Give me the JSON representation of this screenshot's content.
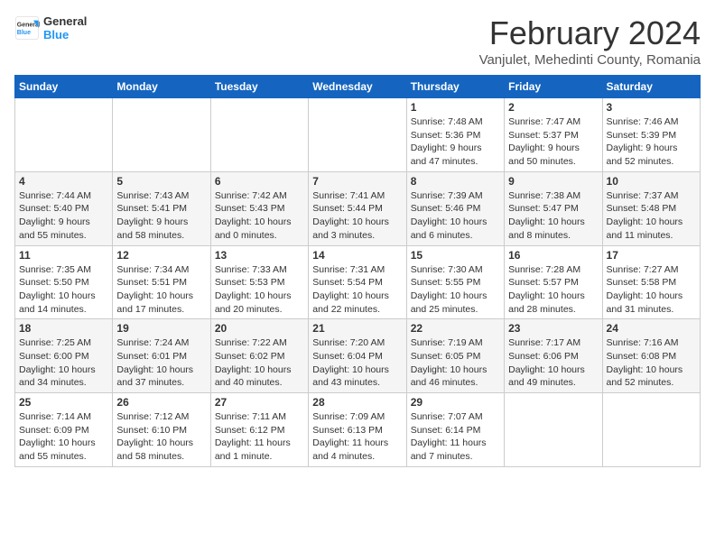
{
  "header": {
    "logo_line1": "General",
    "logo_line2": "Blue",
    "title": "February 2024",
    "subtitle": "Vanjulet, Mehedinti County, Romania"
  },
  "days_of_week": [
    "Sunday",
    "Monday",
    "Tuesday",
    "Wednesday",
    "Thursday",
    "Friday",
    "Saturday"
  ],
  "weeks": [
    [
      {
        "day": "",
        "info": ""
      },
      {
        "day": "",
        "info": ""
      },
      {
        "day": "",
        "info": ""
      },
      {
        "day": "",
        "info": ""
      },
      {
        "day": "1",
        "info": "Sunrise: 7:48 AM\nSunset: 5:36 PM\nDaylight: 9 hours\nand 47 minutes."
      },
      {
        "day": "2",
        "info": "Sunrise: 7:47 AM\nSunset: 5:37 PM\nDaylight: 9 hours\nand 50 minutes."
      },
      {
        "day": "3",
        "info": "Sunrise: 7:46 AM\nSunset: 5:39 PM\nDaylight: 9 hours\nand 52 minutes."
      }
    ],
    [
      {
        "day": "4",
        "info": "Sunrise: 7:44 AM\nSunset: 5:40 PM\nDaylight: 9 hours\nand 55 minutes."
      },
      {
        "day": "5",
        "info": "Sunrise: 7:43 AM\nSunset: 5:41 PM\nDaylight: 9 hours\nand 58 minutes."
      },
      {
        "day": "6",
        "info": "Sunrise: 7:42 AM\nSunset: 5:43 PM\nDaylight: 10 hours\nand 0 minutes."
      },
      {
        "day": "7",
        "info": "Sunrise: 7:41 AM\nSunset: 5:44 PM\nDaylight: 10 hours\nand 3 minutes."
      },
      {
        "day": "8",
        "info": "Sunrise: 7:39 AM\nSunset: 5:46 PM\nDaylight: 10 hours\nand 6 minutes."
      },
      {
        "day": "9",
        "info": "Sunrise: 7:38 AM\nSunset: 5:47 PM\nDaylight: 10 hours\nand 8 minutes."
      },
      {
        "day": "10",
        "info": "Sunrise: 7:37 AM\nSunset: 5:48 PM\nDaylight: 10 hours\nand 11 minutes."
      }
    ],
    [
      {
        "day": "11",
        "info": "Sunrise: 7:35 AM\nSunset: 5:50 PM\nDaylight: 10 hours\nand 14 minutes."
      },
      {
        "day": "12",
        "info": "Sunrise: 7:34 AM\nSunset: 5:51 PM\nDaylight: 10 hours\nand 17 minutes."
      },
      {
        "day": "13",
        "info": "Sunrise: 7:33 AM\nSunset: 5:53 PM\nDaylight: 10 hours\nand 20 minutes."
      },
      {
        "day": "14",
        "info": "Sunrise: 7:31 AM\nSunset: 5:54 PM\nDaylight: 10 hours\nand 22 minutes."
      },
      {
        "day": "15",
        "info": "Sunrise: 7:30 AM\nSunset: 5:55 PM\nDaylight: 10 hours\nand 25 minutes."
      },
      {
        "day": "16",
        "info": "Sunrise: 7:28 AM\nSunset: 5:57 PM\nDaylight: 10 hours\nand 28 minutes."
      },
      {
        "day": "17",
        "info": "Sunrise: 7:27 AM\nSunset: 5:58 PM\nDaylight: 10 hours\nand 31 minutes."
      }
    ],
    [
      {
        "day": "18",
        "info": "Sunrise: 7:25 AM\nSunset: 6:00 PM\nDaylight: 10 hours\nand 34 minutes."
      },
      {
        "day": "19",
        "info": "Sunrise: 7:24 AM\nSunset: 6:01 PM\nDaylight: 10 hours\nand 37 minutes."
      },
      {
        "day": "20",
        "info": "Sunrise: 7:22 AM\nSunset: 6:02 PM\nDaylight: 10 hours\nand 40 minutes."
      },
      {
        "day": "21",
        "info": "Sunrise: 7:20 AM\nSunset: 6:04 PM\nDaylight: 10 hours\nand 43 minutes."
      },
      {
        "day": "22",
        "info": "Sunrise: 7:19 AM\nSunset: 6:05 PM\nDaylight: 10 hours\nand 46 minutes."
      },
      {
        "day": "23",
        "info": "Sunrise: 7:17 AM\nSunset: 6:06 PM\nDaylight: 10 hours\nand 49 minutes."
      },
      {
        "day": "24",
        "info": "Sunrise: 7:16 AM\nSunset: 6:08 PM\nDaylight: 10 hours\nand 52 minutes."
      }
    ],
    [
      {
        "day": "25",
        "info": "Sunrise: 7:14 AM\nSunset: 6:09 PM\nDaylight: 10 hours\nand 55 minutes."
      },
      {
        "day": "26",
        "info": "Sunrise: 7:12 AM\nSunset: 6:10 PM\nDaylight: 10 hours\nand 58 minutes."
      },
      {
        "day": "27",
        "info": "Sunrise: 7:11 AM\nSunset: 6:12 PM\nDaylight: 11 hours\nand 1 minute."
      },
      {
        "day": "28",
        "info": "Sunrise: 7:09 AM\nSunset: 6:13 PM\nDaylight: 11 hours\nand 4 minutes."
      },
      {
        "day": "29",
        "info": "Sunrise: 7:07 AM\nSunset: 6:14 PM\nDaylight: 11 hours\nand 7 minutes."
      },
      {
        "day": "",
        "info": ""
      },
      {
        "day": "",
        "info": ""
      }
    ]
  ]
}
